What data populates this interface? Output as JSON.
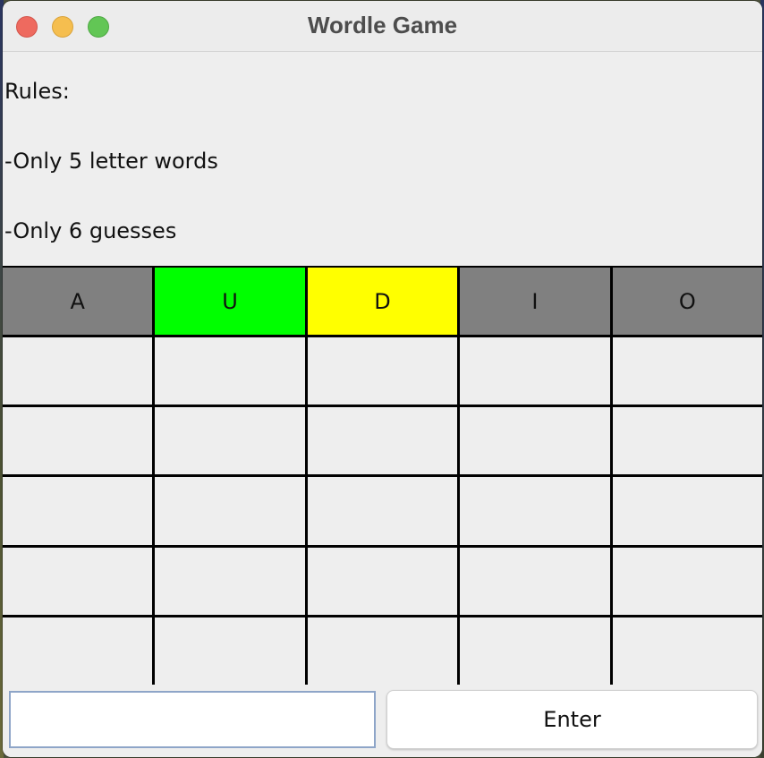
{
  "window": {
    "title": "Wordle Game"
  },
  "rules": {
    "heading": "Rules:",
    "line1": "-Only 5 letter words",
    "line2": "-Only 6 guesses"
  },
  "board": {
    "rows": [
      [
        {
          "letter": "A",
          "color": "#808080"
        },
        {
          "letter": "U",
          "color": "#00ff00"
        },
        {
          "letter": "D",
          "color": "#ffff00"
        },
        {
          "letter": "I",
          "color": "#808080"
        },
        {
          "letter": "O",
          "color": "#808080"
        }
      ],
      [
        {
          "letter": ""
        },
        {
          "letter": ""
        },
        {
          "letter": ""
        },
        {
          "letter": ""
        },
        {
          "letter": ""
        }
      ],
      [
        {
          "letter": ""
        },
        {
          "letter": ""
        },
        {
          "letter": ""
        },
        {
          "letter": ""
        },
        {
          "letter": ""
        }
      ],
      [
        {
          "letter": ""
        },
        {
          "letter": ""
        },
        {
          "letter": ""
        },
        {
          "letter": ""
        },
        {
          "letter": ""
        }
      ],
      [
        {
          "letter": ""
        },
        {
          "letter": ""
        },
        {
          "letter": ""
        },
        {
          "letter": ""
        },
        {
          "letter": ""
        }
      ],
      [
        {
          "letter": ""
        },
        {
          "letter": ""
        },
        {
          "letter": ""
        },
        {
          "letter": ""
        },
        {
          "letter": ""
        }
      ]
    ]
  },
  "input": {
    "value": "",
    "placeholder": ""
  },
  "enter_button": {
    "label": "Enter"
  }
}
